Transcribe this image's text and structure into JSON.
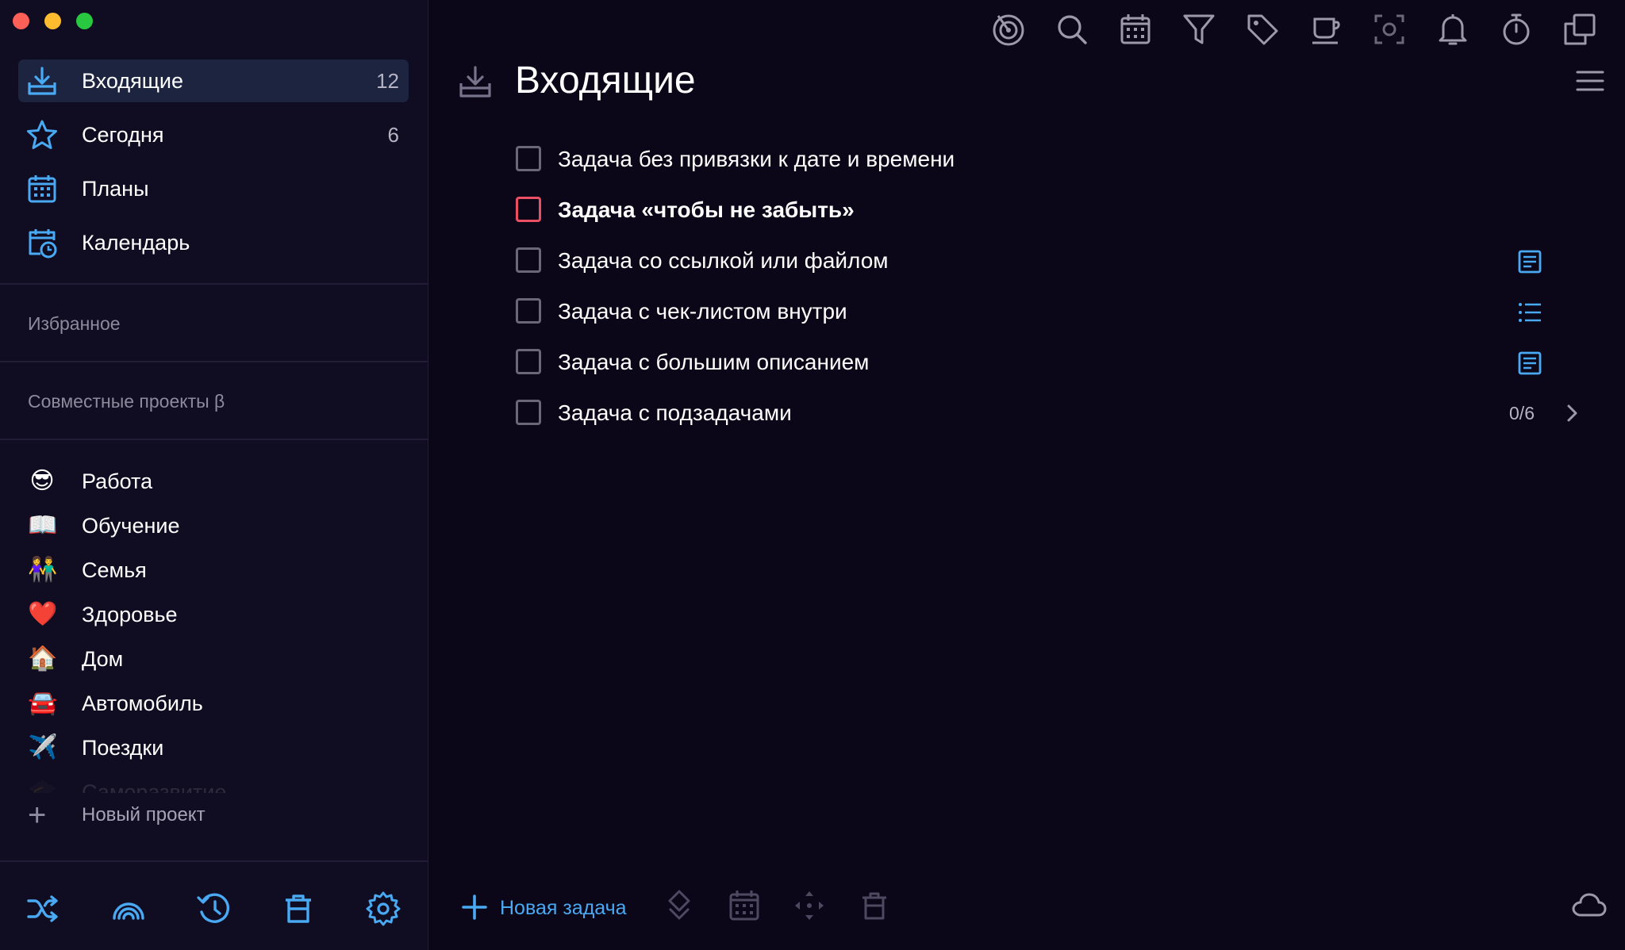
{
  "colors": {
    "accent": "#49a9f3",
    "priority": "#ec4e63",
    "background": "#0b0618",
    "sidebar": "#100c21",
    "active_item": "#1c2440"
  },
  "sidebar": {
    "nav": [
      {
        "label": "Входящие",
        "count": "12",
        "icon": "inbox-icon"
      },
      {
        "label": "Сегодня",
        "count": "6",
        "icon": "star-icon"
      },
      {
        "label": "Планы",
        "count": "",
        "icon": "calendar-grid-icon"
      },
      {
        "label": "Календарь",
        "count": "",
        "icon": "calendar-clock-icon"
      }
    ],
    "favorites_title": "Избранное",
    "shared_title": "Совместные проекты β",
    "projects": [
      {
        "label": "Работа",
        "emoji": "😎"
      },
      {
        "label": "Обучение",
        "emoji": "📖"
      },
      {
        "label": "Семья",
        "emoji": "👫"
      },
      {
        "label": "Здоровье",
        "emoji": "❤️"
      },
      {
        "label": "Дом",
        "emoji": "🏠"
      },
      {
        "label": "Автомобиль",
        "emoji": "🚘"
      },
      {
        "label": "Поездки",
        "emoji": "✈️"
      },
      {
        "label": "Саморазвитие",
        "emoji": "🎓"
      }
    ],
    "new_project_label": "Новый проект",
    "bottom_icons": [
      "shuffle-icon",
      "rainbow-icon",
      "history-icon",
      "trash-icon",
      "settings-icon"
    ]
  },
  "toolbar": {
    "icons": [
      "focus-icon",
      "search-icon",
      "calendar-icon",
      "filter-icon",
      "tag-icon",
      "coffee-icon",
      "screenshot-icon",
      "bell-icon",
      "stopwatch-icon",
      "copy-icon"
    ]
  },
  "main": {
    "title": "Входящие",
    "tasks": [
      {
        "title": "Задача без привязки к дате и времени",
        "priority": false,
        "bold": false,
        "indicator": ""
      },
      {
        "title": "Задача «чтобы не забыть»",
        "priority": true,
        "bold": true,
        "indicator": ""
      },
      {
        "title": "Задача со ссылкой или файлом",
        "priority": false,
        "bold": false,
        "indicator": "note-icon"
      },
      {
        "title": "Задача с чек-листом внутри",
        "priority": false,
        "bold": false,
        "indicator": "checklist-icon"
      },
      {
        "title": "Задача с большим описанием",
        "priority": false,
        "bold": false,
        "indicator": "note-icon"
      },
      {
        "title": "Задача с подзадачами",
        "priority": false,
        "bold": false,
        "indicator": "",
        "progress": "0/6"
      }
    ],
    "new_task_label": "Новая задача",
    "bottom_icons": [
      "priority-icon",
      "date-icon",
      "move-icon",
      "delete-icon",
      "cloud-icon"
    ]
  }
}
